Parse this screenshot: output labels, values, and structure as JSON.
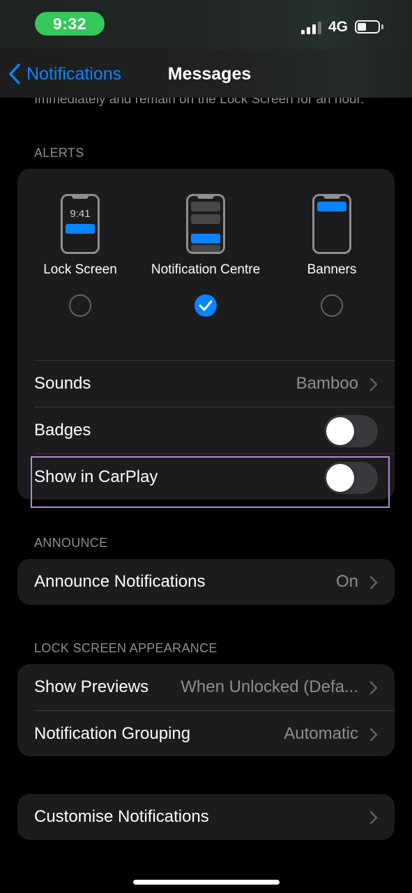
{
  "status_bar": {
    "time": "9:32",
    "network": "4G"
  },
  "nav": {
    "back_label": "Notifications",
    "title": "Messages"
  },
  "clipped_text": "Immediately and remain on the Lock Screen for an hour.",
  "alerts": {
    "header": "ALERTS",
    "options": [
      {
        "label": "Lock Screen",
        "clock": "9:41",
        "selected": false
      },
      {
        "label": "Notification Centre",
        "selected": true
      },
      {
        "label": "Banners",
        "selected": false
      }
    ],
    "sounds": {
      "label": "Sounds",
      "value": "Bamboo"
    },
    "badges": {
      "label": "Badges",
      "on": false
    },
    "carplay": {
      "label": "Show in CarPlay",
      "on": false
    }
  },
  "announce": {
    "header": "ANNOUNCE",
    "row": {
      "label": "Announce Notifications",
      "value": "On"
    }
  },
  "lock_screen": {
    "header": "LOCK SCREEN APPEARANCE",
    "previews": {
      "label": "Show Previews",
      "value": "When Unlocked (Defa..."
    },
    "grouping": {
      "label": "Notification Grouping",
      "value": "Automatic"
    }
  },
  "customise": {
    "label": "Customise Notifications"
  },
  "colors": {
    "accent": "#0a84ff",
    "status_pill": "#34c759",
    "highlight": "#b18ad6"
  }
}
